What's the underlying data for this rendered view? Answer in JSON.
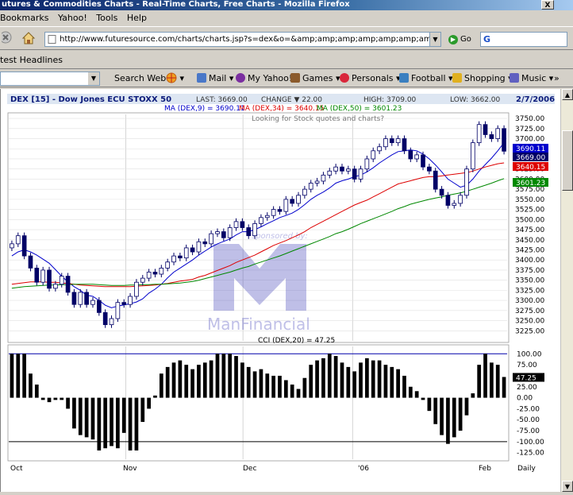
{
  "browser": {
    "title": "utures & Commodities Charts - Real-Time Charts, Free Charts - Mozilla Firefox",
    "close_label": "X",
    "menu": [
      "Bookmarks",
      "Yahoo!",
      "Tools",
      "Help"
    ],
    "url": "http://www.futuresource.com/charts/charts.jsp?s=dex&o=&amp;amp;amp;amp;amp;amp;amp;amp;amp;a=D&",
    "go_label": "Go",
    "search_value": "G",
    "headlines_label": "test Headlines"
  },
  "yahoo_toolbar": {
    "search_label": "Search Web",
    "items": [
      {
        "label": "Mail",
        "color": "#4a78c8"
      },
      {
        "label": "My Yahoo!",
        "color": "#7b2fa0"
      },
      {
        "label": "Games",
        "color": "#8b5a2b"
      },
      {
        "label": "Personals",
        "color": "#d9263a"
      },
      {
        "label": "Football",
        "color": "#3a7fc0"
      },
      {
        "label": "Shopping",
        "color": "#e0b020"
      },
      {
        "label": "Music",
        "color": "#6060c0"
      }
    ],
    "more_label": "»"
  },
  "chart_header": {
    "symbol": "DEX [15] - Dow Jones ECU STOXX 50",
    "last": "LAST: 3669.00",
    "change": "CHANGE ▼ 22.00",
    "high": "HIGH: 3709.00",
    "low": "LOW: 3662.00",
    "date": "2/7/2006",
    "ma9": "MA (DEX,9) = 3690.11",
    "ma34": "MA (DEX,34) = 3640.15",
    "ma50": "MA (DEX,50) = 3601.23",
    "sponsor_text": "sponsored by:",
    "sponsor_name": "ManFinancial",
    "clipped_text": "Looking for Stock quotes and charts?",
    "colors": {
      "ma9": "#0000cc",
      "ma34": "#dd0000",
      "ma50": "#008800",
      "candle": "#000066"
    }
  },
  "chart_data": [
    {
      "type": "candlestick",
      "title": "DEX [15] - Dow Jones ECU STOXX 50",
      "ylim": [
        3200,
        3760
      ],
      "y_ticks": [
        3225,
        3250,
        3275,
        3300,
        3325,
        3350,
        3375,
        3400,
        3425,
        3450,
        3475,
        3500,
        3525,
        3550,
        3575,
        3600,
        3625,
        3650,
        3675,
        3700,
        3725,
        3750
      ],
      "price_tags": [
        {
          "value": "3690.11",
          "color": "#0000cc"
        },
        {
          "value": "3669.00",
          "color": "#000066"
        },
        {
          "value": "3640.15",
          "color": "#dd0000"
        },
        {
          "value": "3601.23",
          "color": "#008800"
        }
      ],
      "x_labels": [
        "Oct",
        "Nov",
        "Dec",
        "'06",
        "Feb",
        "Daily"
      ],
      "close": [
        3440,
        3460,
        3410,
        3380,
        3345,
        3375,
        3330,
        3340,
        3360,
        3320,
        3290,
        3320,
        3290,
        3300,
        3270,
        3240,
        3255,
        3295,
        3290,
        3310,
        3345,
        3355,
        3370,
        3365,
        3380,
        3395,
        3410,
        3405,
        3430,
        3420,
        3445,
        3440,
        3465,
        3470,
        3455,
        3480,
        3495,
        3480,
        3460,
        3490,
        3505,
        3510,
        3525,
        3520,
        3550,
        3540,
        3560,
        3575,
        3590,
        3595,
        3610,
        3620,
        3630,
        3620,
        3625,
        3600,
        3625,
        3650,
        3670,
        3680,
        3700,
        3690,
        3700,
        3670,
        3650,
        3660,
        3630,
        3620,
        3575,
        3560,
        3535,
        3540,
        3560,
        3625,
        3690,
        3735,
        3710,
        3700,
        3725,
        3669
      ],
      "series": [
        {
          "name": "MA (DEX,9)",
          "values": [
            3410,
            3420,
            3425,
            3420,
            3412,
            3402,
            3392,
            3376,
            3360,
            3346,
            3334,
            3325,
            3313,
            3310,
            3300,
            3288,
            3282,
            3286,
            3289,
            3292,
            3296,
            3304,
            3318,
            3328,
            3340,
            3356,
            3370,
            3380,
            3390,
            3400,
            3412,
            3422,
            3432,
            3440,
            3446,
            3452,
            3462,
            3470,
            3470,
            3475,
            3482,
            3490,
            3497,
            3505,
            3510,
            3516,
            3525,
            3537,
            3550,
            3560,
            3568,
            3578,
            3590,
            3596,
            3600,
            3606,
            3610,
            3618,
            3628,
            3640,
            3650,
            3660,
            3668,
            3670,
            3672,
            3670,
            3662,
            3650,
            3635,
            3618,
            3600,
            3590,
            3580,
            3585,
            3600,
            3620,
            3636,
            3652,
            3670,
            3690.11
          ]
        },
        {
          "name": "MA (DEX,34)",
          "values": [
            3340,
            3342,
            3344,
            3346,
            3346,
            3346,
            3345,
            3345,
            3343,
            3342,
            3340,
            3338,
            3337,
            3336,
            3335,
            3334,
            3334,
            3334,
            3334,
            3334,
            3335,
            3336,
            3337,
            3338,
            3340,
            3342,
            3345,
            3348,
            3350,
            3352,
            3358,
            3362,
            3368,
            3374,
            3380,
            3386,
            3394,
            3400,
            3406,
            3412,
            3420,
            3428,
            3436,
            3442,
            3448,
            3455,
            3462,
            3470,
            3480,
            3488,
            3496,
            3504,
            3512,
            3520,
            3528,
            3536,
            3542,
            3548,
            3556,
            3564,
            3572,
            3580,
            3588,
            3592,
            3596,
            3600,
            3604,
            3606,
            3606,
            3608,
            3610,
            3612,
            3614,
            3616,
            3620,
            3625,
            3630,
            3634,
            3638,
            3640.15
          ]
        },
        {
          "name": "MA (DEX,50)",
          "values": [
            3330,
            3332,
            3334,
            3335,
            3336,
            3337,
            3338,
            3338,
            3339,
            3339,
            3340,
            3340,
            3340,
            3340,
            3339,
            3338,
            3337,
            3337,
            3337,
            3338,
            3338,
            3339,
            3339,
            3340,
            3340,
            3341,
            3342,
            3343,
            3345,
            3347,
            3350,
            3354,
            3358,
            3362,
            3366,
            3370,
            3375,
            3380,
            3384,
            3390,
            3395,
            3400,
            3405,
            3410,
            3416,
            3422,
            3428,
            3434,
            3440,
            3446,
            3452,
            3458,
            3465,
            3470,
            3476,
            3483,
            3490,
            3496,
            3502,
            3508,
            3514,
            3520,
            3527,
            3532,
            3538,
            3542,
            3546,
            3550,
            3553,
            3556,
            3560,
            3563,
            3566,
            3570,
            3575,
            3580,
            3585,
            3590,
            3596,
            3601.23
          ]
        }
      ]
    },
    {
      "type": "bar",
      "title": "CCI (DEX,20) = 47.25",
      "ylim": [
        -140,
        115
      ],
      "y_ticks": [
        100,
        75,
        50,
        25,
        0,
        -25,
        -50,
        -75,
        -100,
        -125
      ],
      "reference_lines": [
        100,
        -100
      ],
      "last_value": "47.25",
      "values": [
        100,
        100,
        100,
        55,
        30,
        -5,
        -10,
        -5,
        -5,
        -25,
        -70,
        -85,
        -90,
        -95,
        -120,
        -115,
        -110,
        -115,
        -80,
        -120,
        -120,
        -55,
        -25,
        5,
        55,
        70,
        80,
        85,
        75,
        65,
        75,
        80,
        85,
        100,
        100,
        100,
        95,
        80,
        70,
        60,
        65,
        55,
        50,
        50,
        40,
        30,
        20,
        45,
        75,
        85,
        90,
        100,
        95,
        80,
        70,
        60,
        80,
        90,
        85,
        85,
        75,
        70,
        65,
        50,
        25,
        15,
        -5,
        -30,
        -60,
        -85,
        -105,
        -90,
        -75,
        -40,
        10,
        75,
        100,
        80,
        75,
        47.25
      ]
    }
  ]
}
